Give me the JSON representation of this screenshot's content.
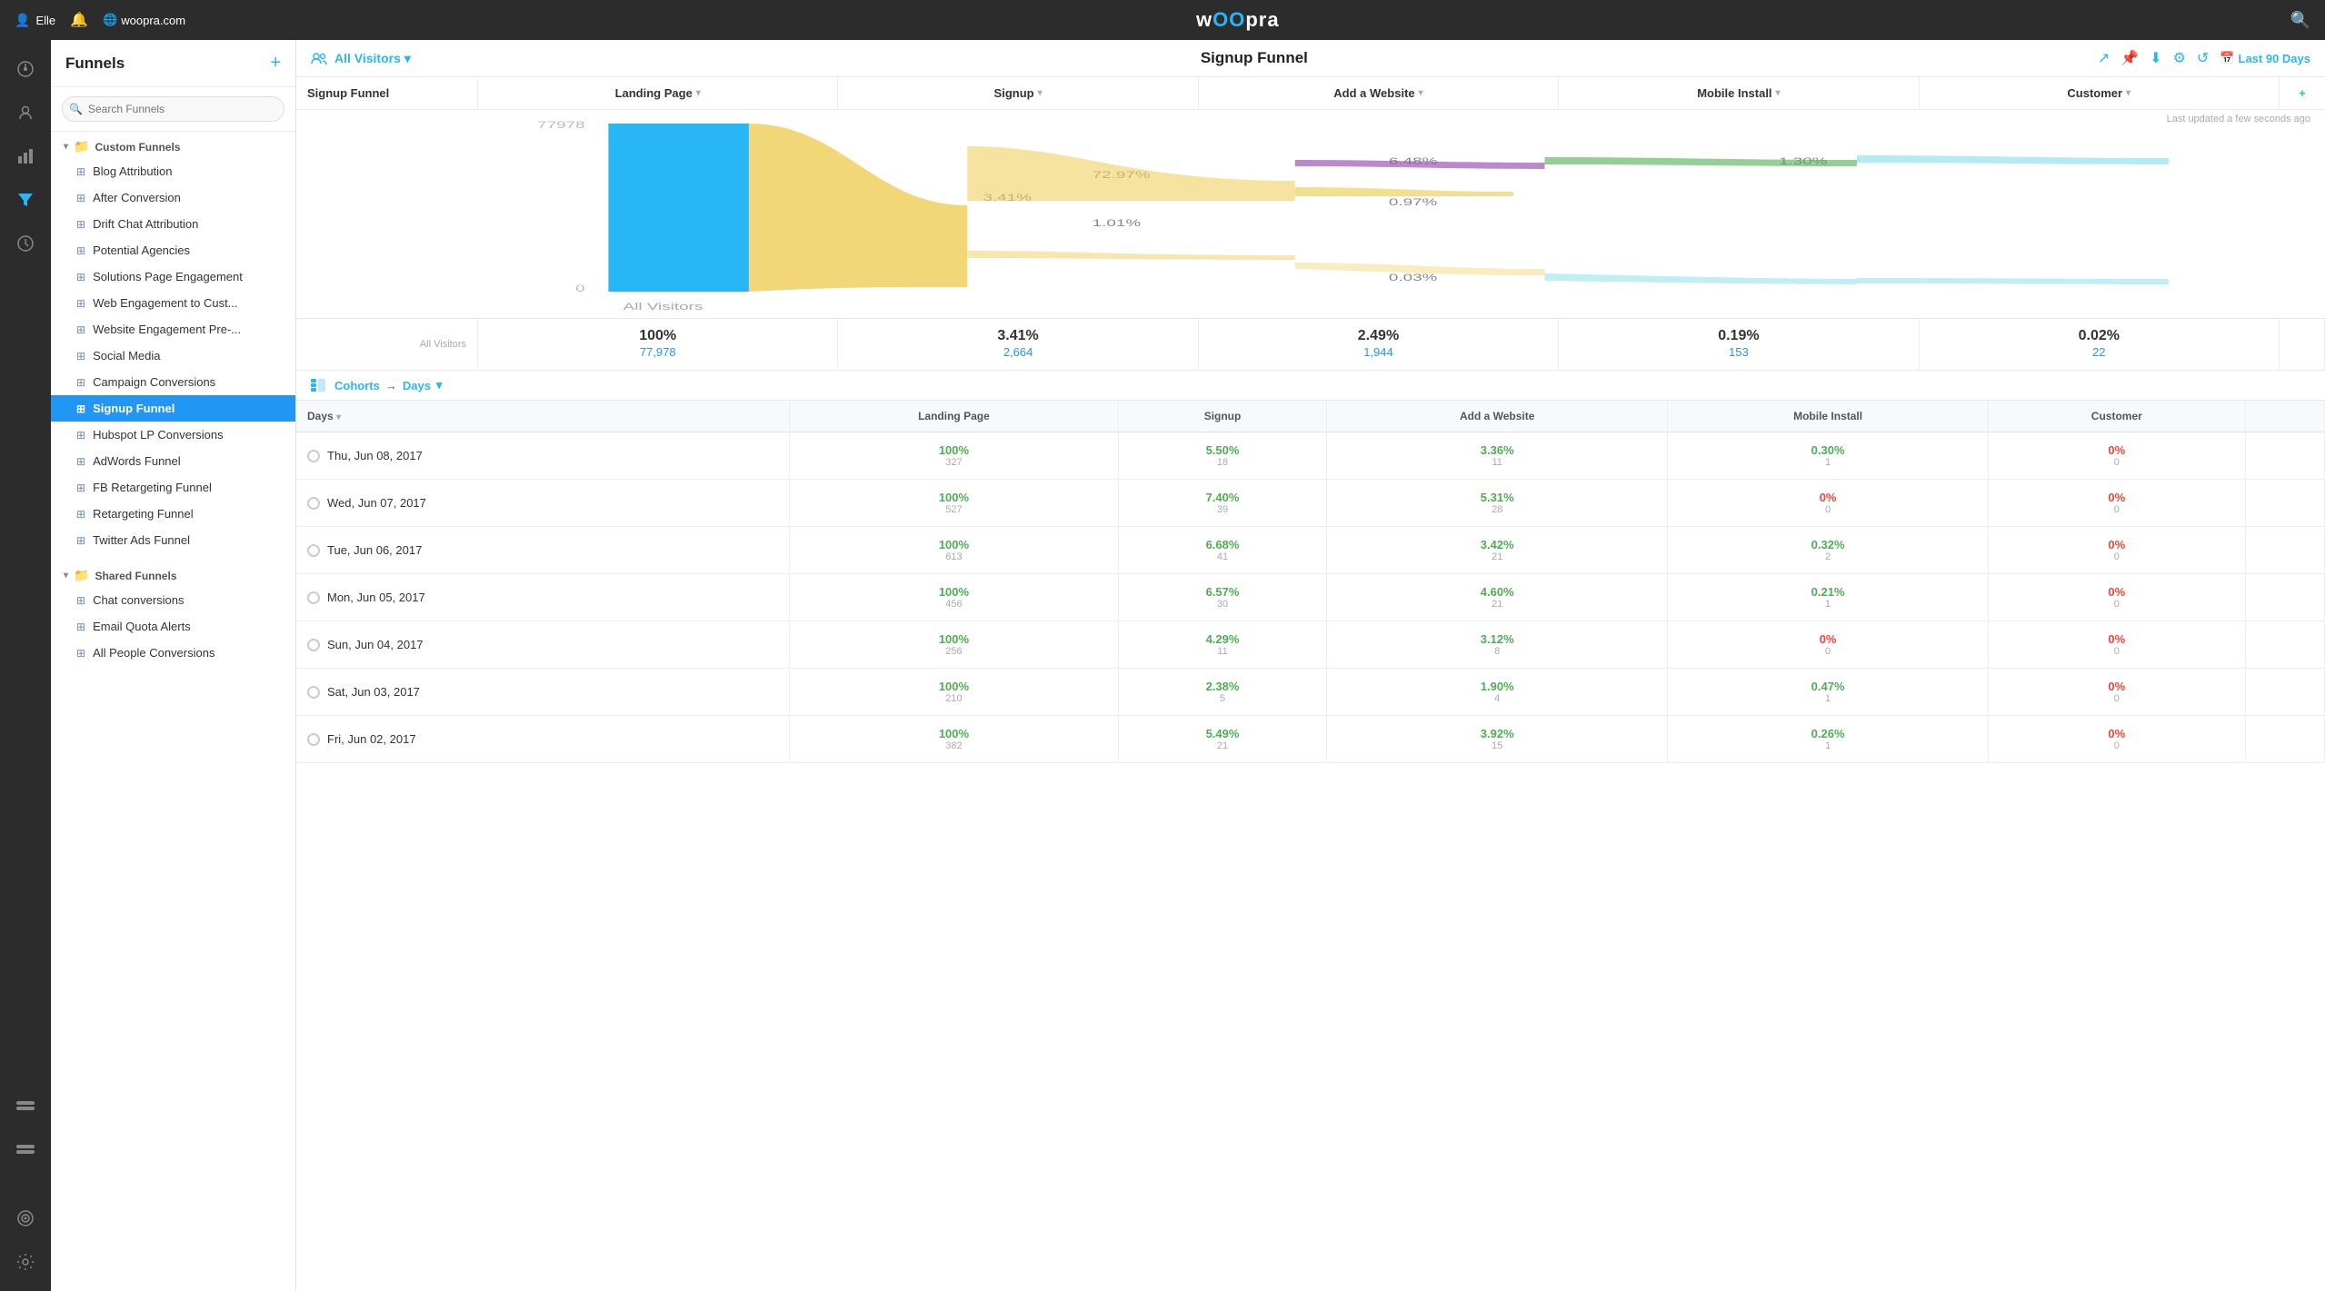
{
  "topNav": {
    "user": "Elle",
    "site": "woopra.com",
    "logoText": "wOOpra"
  },
  "sidebar": {
    "title": "Funnels",
    "searchPlaceholder": "Search Funnels",
    "customFunnels": {
      "label": "Custom Funnels",
      "items": [
        "Blog Attribution",
        "After Conversion",
        "Drift Chat Attribution",
        "Potential Agencies",
        "Solutions Page Engagement",
        "Web Engagement to Cust...",
        "Website Engagement Pre-...",
        "Social Media",
        "Campaign Conversions",
        "Signup Funnel",
        "Hubspot LP Conversions",
        "AdWords Funnel",
        "FB Retargeting Funnel",
        "Retargeting Funnel",
        "Twitter Ads Funnel"
      ]
    },
    "sharedFunnels": {
      "label": "Shared Funnels",
      "items": [
        "Chat conversions",
        "Email Quota Alerts",
        "All People Conversions"
      ]
    }
  },
  "funnel": {
    "title": "Signup Funnel",
    "audienceLabel": "All Visitors",
    "lastUpdated": "Last updated a few seconds ago",
    "dateRange": "Last 90 Days",
    "columns": [
      "Signup Funnel",
      "Landing Page",
      "Signup",
      "Add a Website",
      "Mobile Install",
      "Customer"
    ],
    "stats": [
      {
        "percent": "100%",
        "count": "77,978"
      },
      {
        "percent": "3.41%",
        "count": "2,664"
      },
      {
        "percent": "2.49%",
        "count": "1,944"
      },
      {
        "percent": "0.19%",
        "count": "153"
      },
      {
        "percent": "0.02%",
        "count": "22"
      }
    ],
    "vizTop": "77978",
    "vizBottom": "0",
    "vizLabel": "All Visitors",
    "flowPercents": [
      "3.41%",
      "72.97%",
      "1.01%",
      "6.48%",
      "0.97%",
      "1.30%",
      "0.03%"
    ],
    "cohortsLabel": "Cohorts",
    "daysLabel": "Days",
    "tableColumns": [
      "Days",
      "Landing Page",
      "Signup",
      "Add a Website",
      "Mobile Install",
      "Customer"
    ],
    "rows": [
      {
        "date": "Thu, Jun 08, 2017",
        "cells": [
          {
            "percent": "100%",
            "count": "327",
            "color": "green"
          },
          {
            "percent": "5.50%",
            "count": "18",
            "color": "green"
          },
          {
            "percent": "3.36%",
            "count": "11",
            "color": "green"
          },
          {
            "percent": "0.30%",
            "count": "1",
            "color": "green"
          },
          {
            "percent": "0%",
            "count": "0",
            "color": "red"
          }
        ]
      },
      {
        "date": "Wed, Jun 07, 2017",
        "cells": [
          {
            "percent": "100%",
            "count": "527",
            "color": "green"
          },
          {
            "percent": "7.40%",
            "count": "39",
            "color": "green"
          },
          {
            "percent": "5.31%",
            "count": "28",
            "color": "green"
          },
          {
            "percent": "0%",
            "count": "0",
            "color": "red"
          },
          {
            "percent": "0%",
            "count": "0",
            "color": "red"
          }
        ]
      },
      {
        "date": "Tue, Jun 06, 2017",
        "cells": [
          {
            "percent": "100%",
            "count": "613",
            "color": "green"
          },
          {
            "percent": "6.68%",
            "count": "41",
            "color": "green"
          },
          {
            "percent": "3.42%",
            "count": "21",
            "color": "green"
          },
          {
            "percent": "0.32%",
            "count": "2",
            "color": "green"
          },
          {
            "percent": "0%",
            "count": "0",
            "color": "red"
          }
        ]
      },
      {
        "date": "Mon, Jun 05, 2017",
        "cells": [
          {
            "percent": "100%",
            "count": "456",
            "color": "green"
          },
          {
            "percent": "6.57%",
            "count": "30",
            "color": "green"
          },
          {
            "percent": "4.60%",
            "count": "21",
            "color": "green"
          },
          {
            "percent": "0.21%",
            "count": "1",
            "color": "green"
          },
          {
            "percent": "0%",
            "count": "0",
            "color": "red"
          }
        ]
      },
      {
        "date": "Sun, Jun 04, 2017",
        "cells": [
          {
            "percent": "100%",
            "count": "256",
            "color": "green"
          },
          {
            "percent": "4.29%",
            "count": "11",
            "color": "green"
          },
          {
            "percent": "3.12%",
            "count": "8",
            "color": "green"
          },
          {
            "percent": "0%",
            "count": "0",
            "color": "red"
          },
          {
            "percent": "0%",
            "count": "0",
            "color": "red"
          }
        ]
      },
      {
        "date": "Sat, Jun 03, 2017",
        "cells": [
          {
            "percent": "100%",
            "count": "210",
            "color": "green"
          },
          {
            "percent": "2.38%",
            "count": "5",
            "color": "green"
          },
          {
            "percent": "1.90%",
            "count": "4",
            "color": "green"
          },
          {
            "percent": "0.47%",
            "count": "1",
            "color": "green"
          },
          {
            "percent": "0%",
            "count": "0",
            "color": "red"
          }
        ]
      },
      {
        "date": "Fri, Jun 02, 2017",
        "cells": [
          {
            "percent": "100%",
            "count": "382",
            "color": "green"
          },
          {
            "percent": "5.49%",
            "count": "21",
            "color": "green"
          },
          {
            "percent": "3.92%",
            "count": "15",
            "color": "green"
          },
          {
            "percent": "0.26%",
            "count": "1",
            "color": "green"
          },
          {
            "percent": "0%",
            "count": "0",
            "color": "red"
          }
        ]
      }
    ]
  },
  "icons": {
    "dashboard": "⊙",
    "people": "👤",
    "chart": "📊",
    "filter": "▼",
    "clock": "⏱",
    "toggle1": "⊟",
    "toggle2": "⊟",
    "target": "◎",
    "wrench": "🔧",
    "search": "🔍",
    "bell": "🔔",
    "globe": "🌐",
    "share": "↗",
    "pin": "📌",
    "download": "⬇",
    "gear": "⚙",
    "refresh": "↺",
    "calendar": "📅",
    "plus": "+",
    "chevronDown": "▾",
    "chevronRight": "▸",
    "listIcon": "≡",
    "arrowRight": "→"
  }
}
